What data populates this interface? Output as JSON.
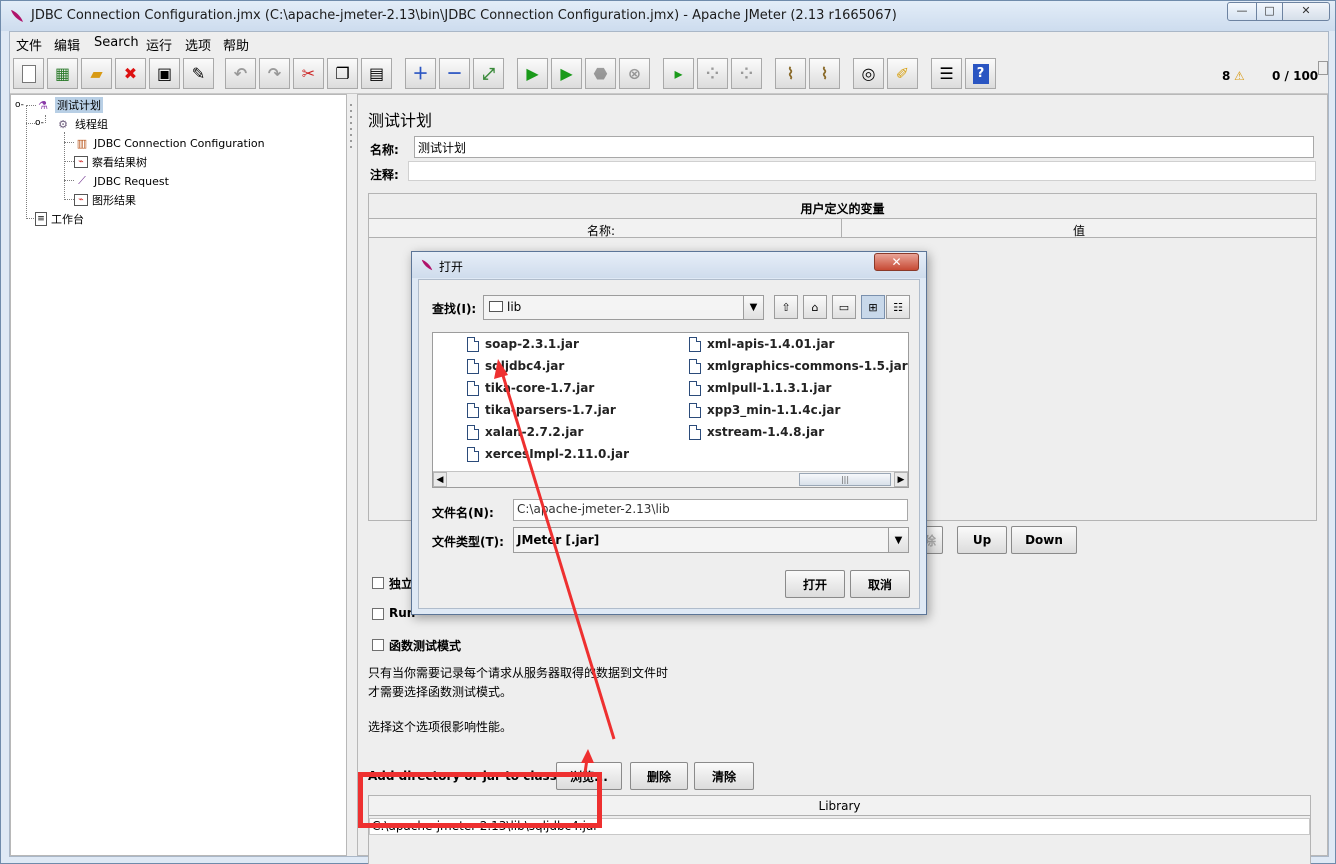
{
  "window": {
    "title": "JDBC Connection Configuration.jmx (C:\\apache-jmeter-2.13\\bin\\JDBC Connection Configuration.jmx) - Apache JMeter (2.13 r1665067)",
    "controls": {
      "minimize": "—",
      "maximize": "□",
      "close": "✕"
    }
  },
  "menu": [
    "文件",
    "编辑",
    "Search",
    "运行",
    "选项",
    "帮助"
  ],
  "toolbar": {
    "icons": [
      "new-icon",
      "templates-icon",
      "open-icon",
      "close-icon",
      "save-icon",
      "save-as-icon",
      "undo-icon",
      "redo-icon",
      "cut-icon",
      "copy-icon",
      "paste-icon",
      "expand-icon",
      "collapse-icon",
      "toggle-icon",
      "start-icon",
      "start-no-pause-icon",
      "stop-icon",
      "shutdown-icon",
      "remote-start-icon",
      "remote-stop-icon",
      "remote-shutdown-icon",
      "clear-icon",
      "clear-all-icon",
      "search-icon",
      "reset-search-icon",
      "function-helper-icon",
      "help-icon"
    ],
    "warning_count": "8",
    "thread_count": "0 / 100"
  },
  "tree": [
    {
      "label": "测试计划",
      "icon": "test-plan-icon",
      "selected": true
    },
    {
      "label": "线程组",
      "icon": "thread-group-icon"
    },
    {
      "label": "JDBC Connection Configuration",
      "icon": "config-element-icon"
    },
    {
      "label": "察看结果树",
      "icon": "listener-icon"
    },
    {
      "label": "JDBC Request",
      "icon": "sampler-icon"
    },
    {
      "label": "图形结果",
      "icon": "listener-icon"
    },
    {
      "label": "工作台",
      "icon": "workbench-icon"
    }
  ],
  "panel": {
    "title": "测试计划",
    "name_label": "名称:",
    "name_value": "测试计划",
    "comment_label": "注释:",
    "comment_value": "",
    "vars_title": "用户定义的变量",
    "vars_col_name": "名称:",
    "vars_col_value": "值",
    "btn_up": "Up",
    "btn_down": "Down",
    "btn_delete_partial": "除",
    "chk_serialize": "独立",
    "chk_teardown": "Run",
    "chk_functional": "函数测试模式",
    "note1": "只有当你需要记录每个请求从服务器取得的数据到文件时",
    "note2": "才需要选择函数测试模式。",
    "note3": "选择这个选项很影响性能。",
    "classpath_label": "Add directory or jar to classpath",
    "btn_browse": "浏览...",
    "btn_remove": "删除",
    "btn_clear": "清除",
    "library_header": "Library",
    "library_rows": [
      "C:\\apache-jmeter-2.13\\lib\\sqljdbc4.jar"
    ]
  },
  "dialog": {
    "title": "打开",
    "lookin_label": "查找(I):",
    "lookin_value": "lib",
    "files_col1": [
      "soap-2.3.1.jar",
      "sqljdbc4.jar",
      "tika-core-1.7.jar",
      "tika-parsers-1.7.jar",
      "xalan-2.7.2.jar",
      "xercesImpl-2.11.0.jar"
    ],
    "files_col2": [
      "xml-apis-1.4.01.jar",
      "xmlgraphics-commons-1.5.jar",
      "xmlpull-1.1.3.1.jar",
      "xpp3_min-1.1.4c.jar",
      "xstream-1.4.8.jar"
    ],
    "filename_label": "文件名(N):",
    "filename_value": "C:\\apache-jmeter-2.13\\lib",
    "filetype_label": "文件类型(T):",
    "filetype_value": "JMeter [.jar]",
    "btn_open": "打开",
    "btn_cancel": "取消",
    "close": "✕"
  },
  "colors": {
    "annotation": "#ee3030",
    "selection": "#b8cfe5"
  }
}
